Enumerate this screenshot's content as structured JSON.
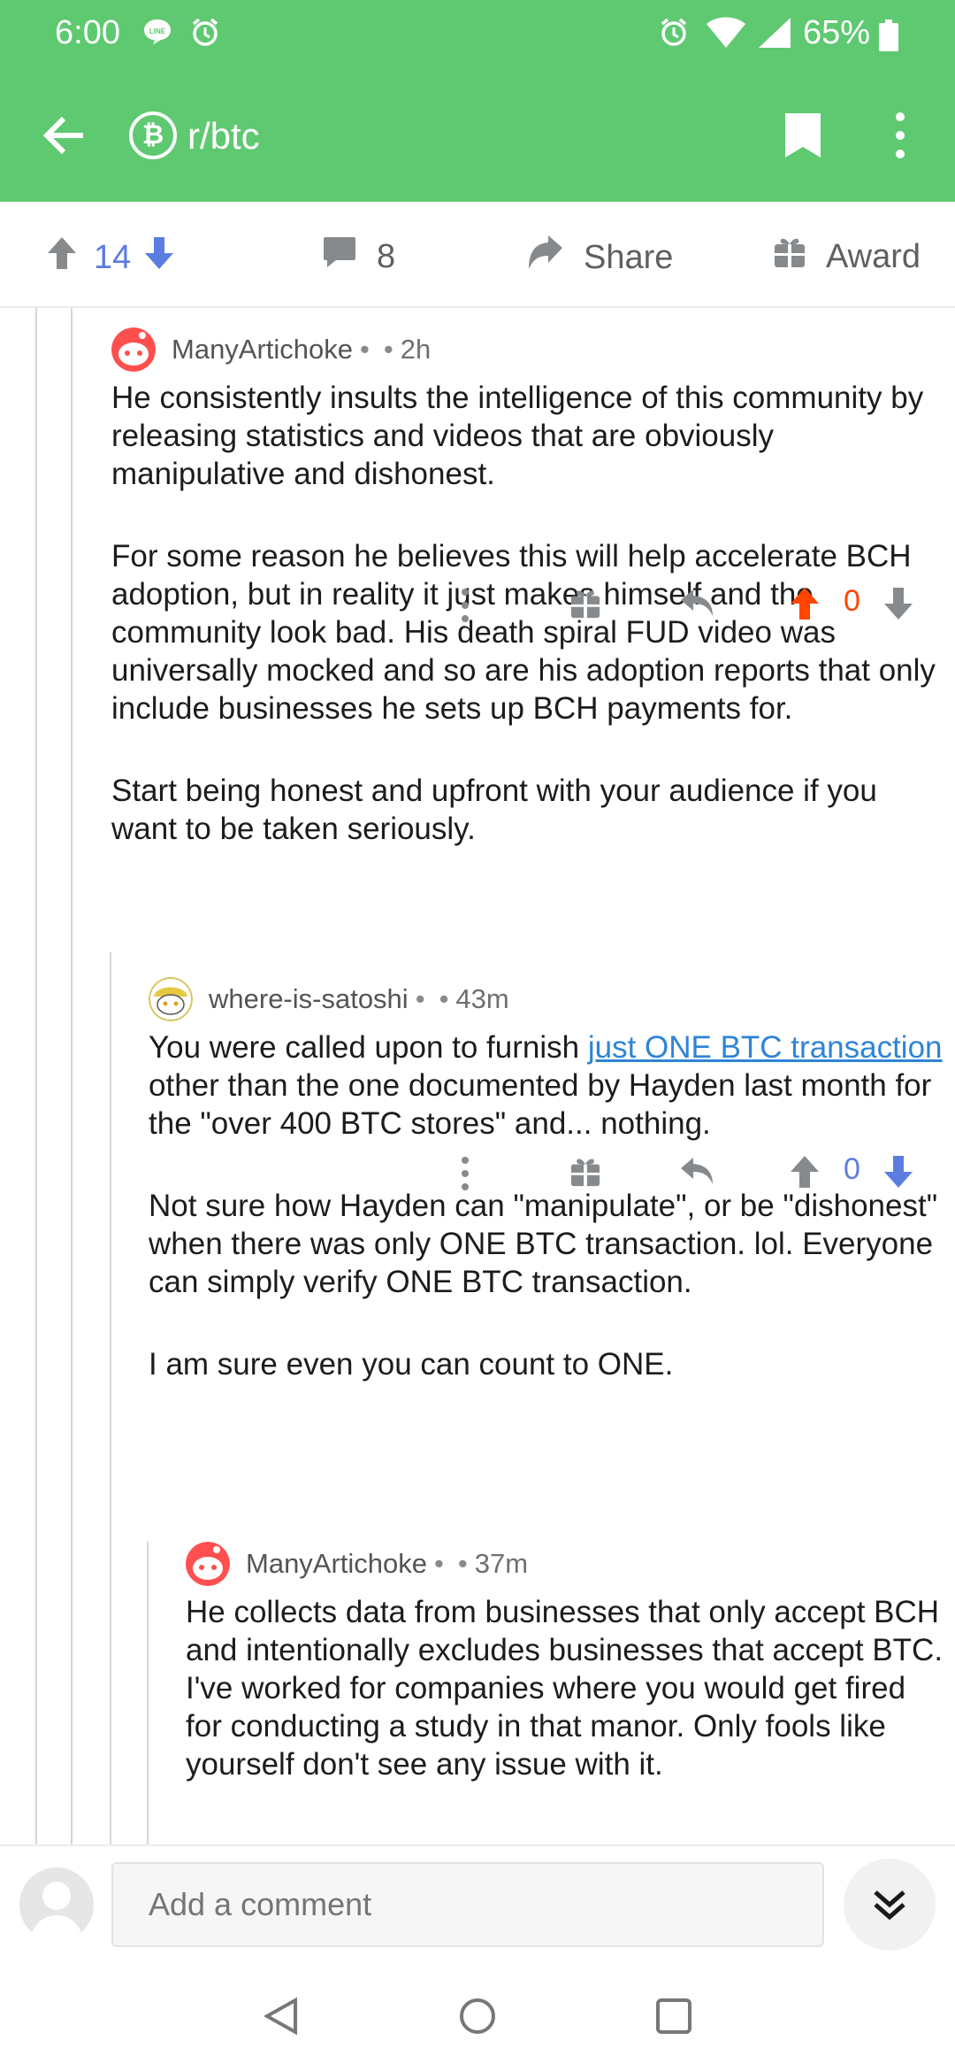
{
  "status_bar": {
    "time": "6:00",
    "battery": "65%"
  },
  "app_bar": {
    "subreddit": "r/btc",
    "subreddit_icon": "bitcoin-icon"
  },
  "post_actions": {
    "score": "14",
    "comments": "8",
    "share_label": "Share",
    "award_label": "Award"
  },
  "comments": [
    {
      "author": "ManyArtichoke",
      "age": "2h",
      "paragraphs": [
        "He consistently insults the intelligence of this community by releasing statistics and videos that are obviously manipulative and dishonest.",
        "For some reason he believes this will help accelerate BCH adoption, but in reality it just makes himself and the community look bad. His death spiral FUD video was universally mocked and so are his adoption reports that only include businesses he sets up BCH payments for.",
        "Start being honest and upfront with your audience if you want to be taken seriously."
      ],
      "score": "0",
      "vote_state": "upvoted"
    },
    {
      "author": "where-is-satoshi",
      "age": "43m",
      "paragraph1_before_link": "You were called upon to furnish ",
      "paragraph1_link": "just ONE BTC transaction",
      "paragraph1_after_link": " other than the one documented by Hayden last month for the \"over 400 BTC stores\" and... nothing.",
      "paragraph2": "Not sure how Hayden can \"manipulate\", or be \"dishonest\" when there was only ONE BTC transaction. lol. Everyone can simply verify ONE BTC transaction.",
      "paragraph3": "I am sure even you can count to ONE.",
      "score": "0",
      "vote_state": "downvoted"
    },
    {
      "author": "ManyArtichoke",
      "age": "37m",
      "paragraphs": [
        "He collects data from businesses that only accept BCH and intentionally excludes businesses that accept BTC. I've worked for companies where you would get fired for conducting a study in that manor. Only fools like yourself don't see any issue with it."
      ]
    }
  ],
  "comment_input": {
    "placeholder": "Add a comment"
  },
  "colors": {
    "header_green": "#5fc971",
    "upvote_orange": "#ff4500",
    "downvote_blue": "#5c7de0",
    "link_blue": "#2e84d6"
  }
}
